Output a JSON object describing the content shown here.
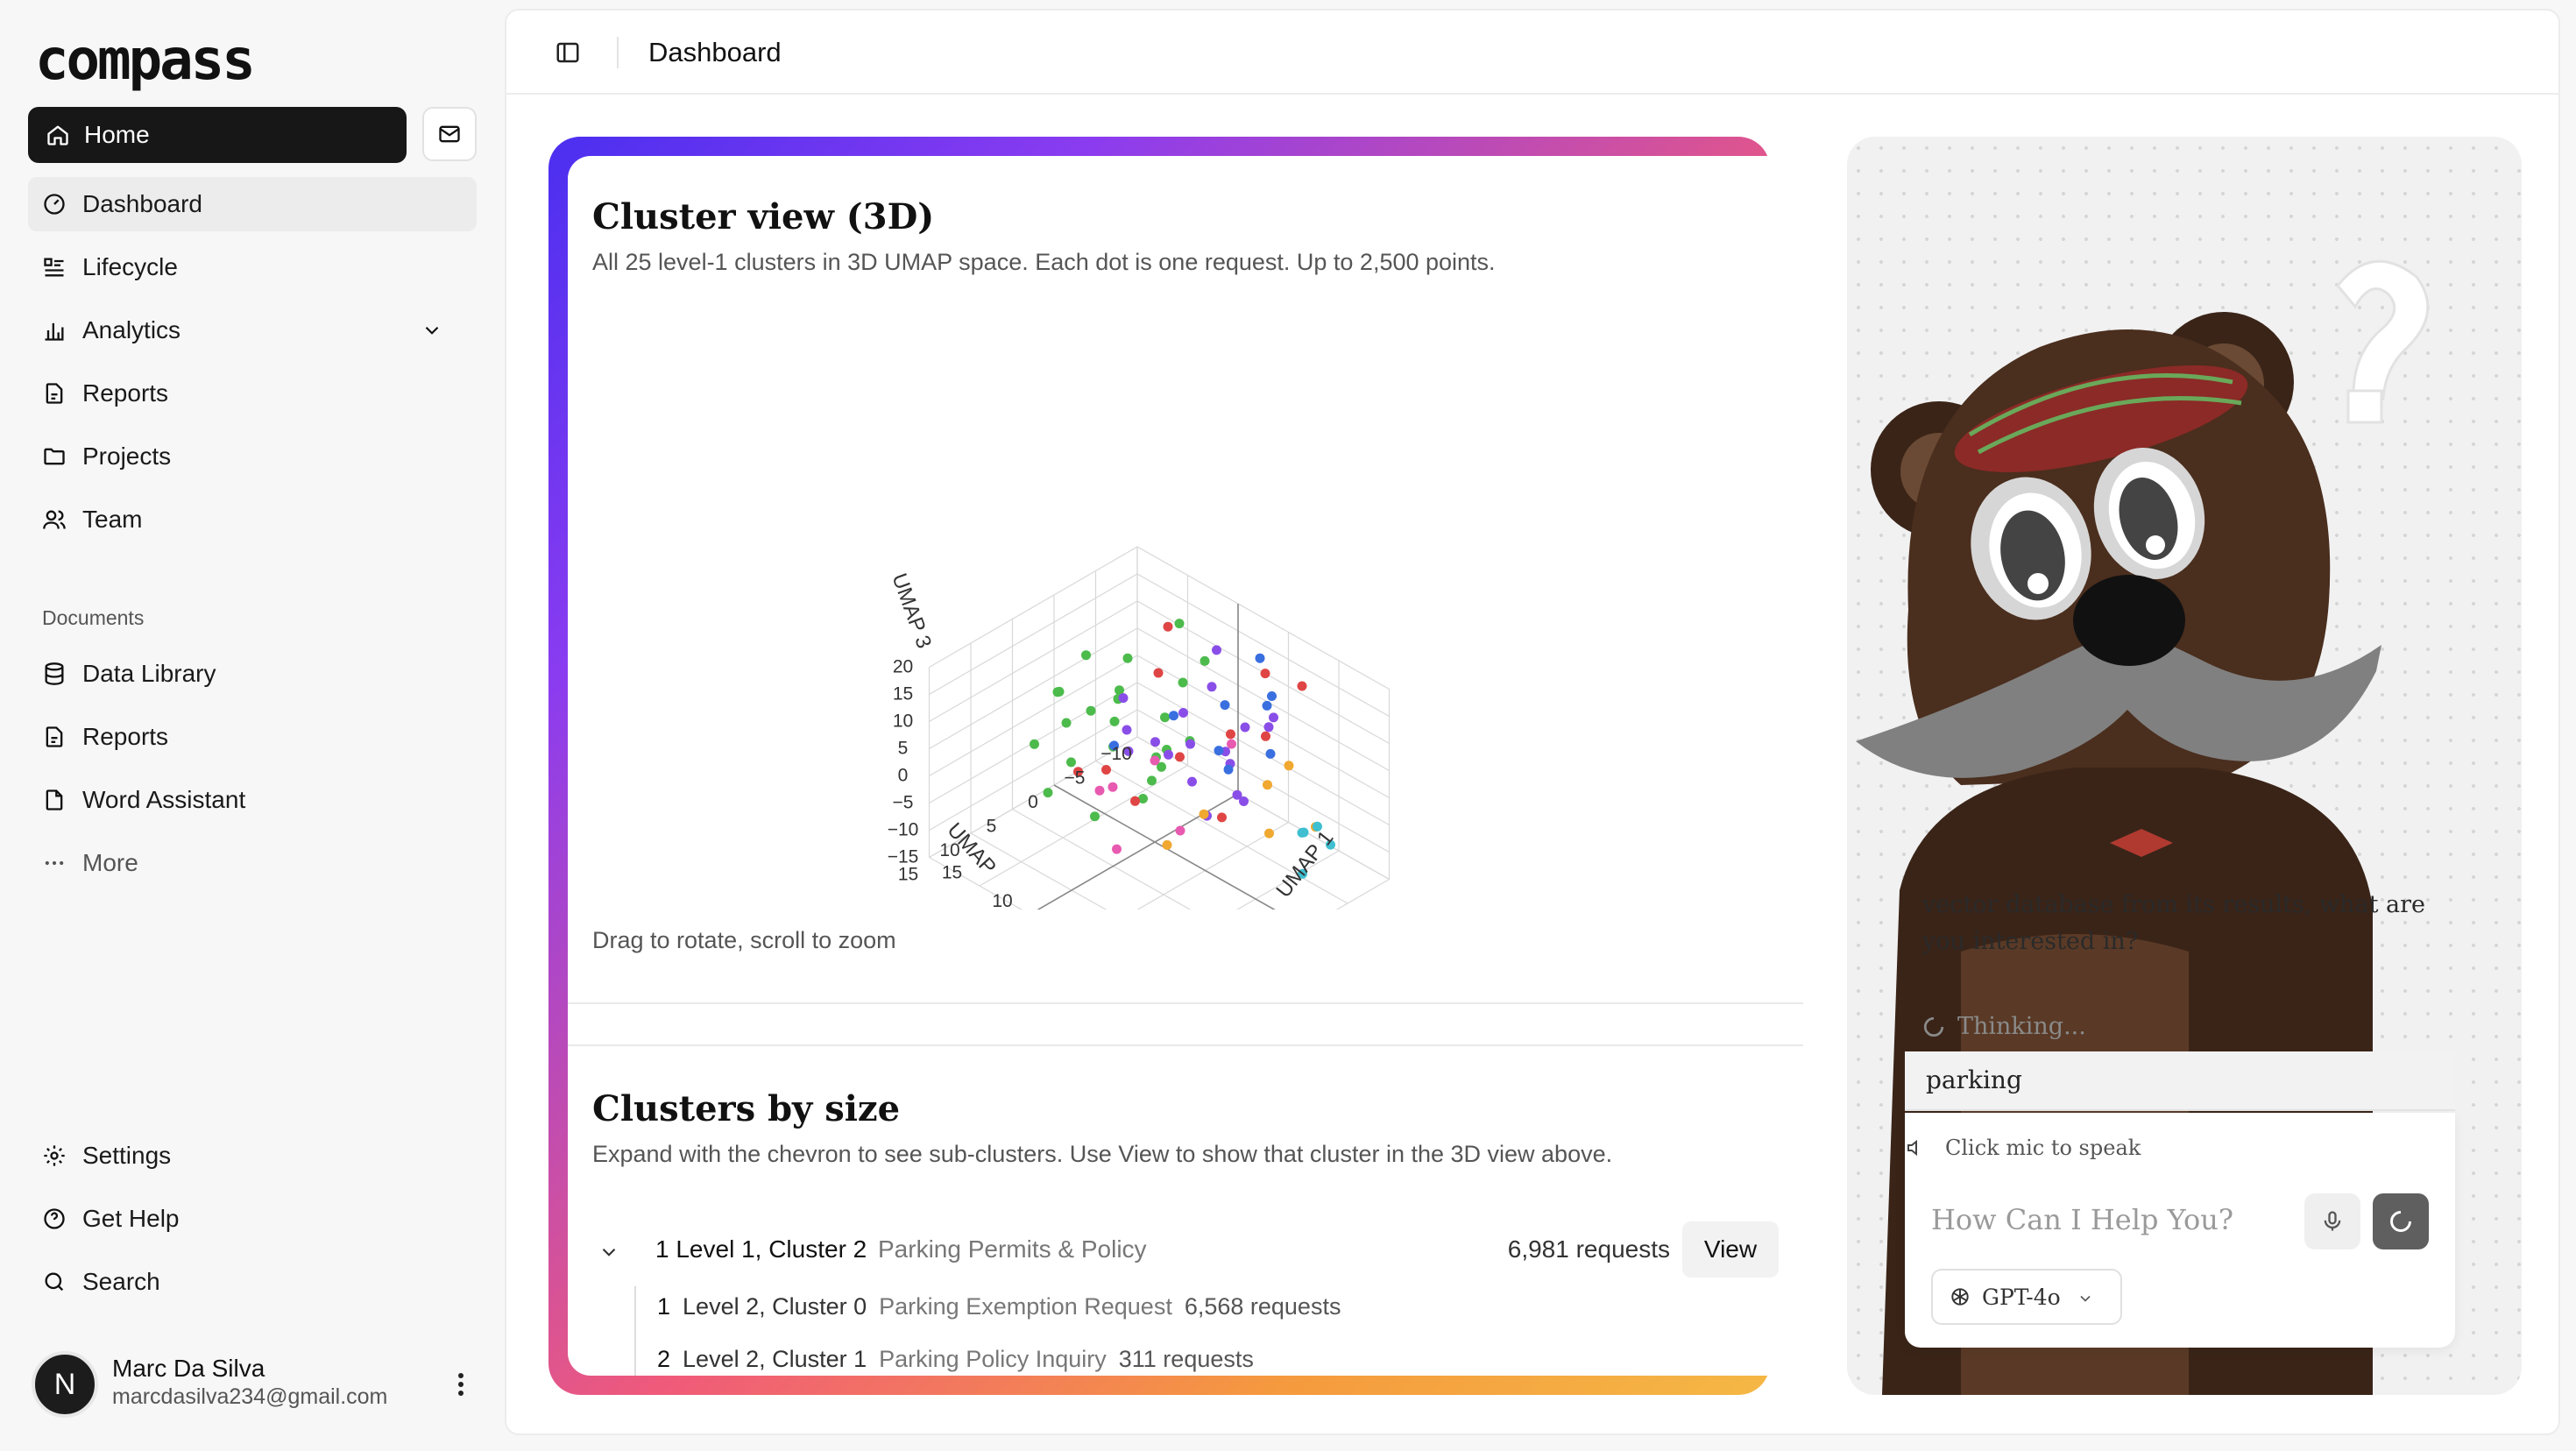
{
  "app": {
    "logo": "compass"
  },
  "sidebar": {
    "home_label": "Home",
    "items": [
      {
        "label": "Dashboard",
        "icon": "dashboard-icon"
      },
      {
        "label": "Lifecycle",
        "icon": "list-icon"
      },
      {
        "label": "Analytics",
        "icon": "bar-chart-icon"
      },
      {
        "label": "Reports",
        "icon": "report-icon"
      },
      {
        "label": "Projects",
        "icon": "folder-icon"
      },
      {
        "label": "Team",
        "icon": "users-icon"
      }
    ],
    "documents_label": "Documents",
    "doc_items": [
      {
        "label": "Data Library",
        "icon": "database-icon"
      },
      {
        "label": "Reports",
        "icon": "report-icon"
      },
      {
        "label": "Word Assistant",
        "icon": "document-icon"
      },
      {
        "label": "More",
        "icon": "more-icon"
      }
    ],
    "bottom_items": [
      {
        "label": "Settings",
        "icon": "gear-icon"
      },
      {
        "label": "Get Help",
        "icon": "help-icon"
      },
      {
        "label": "Search",
        "icon": "search-icon"
      }
    ],
    "user": {
      "initial": "N",
      "name": "Marc Da Silva",
      "email": "marcdasilva234@gmail.com"
    }
  },
  "header": {
    "breadcrumb": "Dashboard"
  },
  "cluster_view": {
    "title": "Cluster view (3D)",
    "subtitle": "All 25 level-1 clusters in 3D UMAP space. Each dot is one request. Up to 2,500 points.",
    "hint": "Drag to rotate, scroll to zoom",
    "axes": {
      "z_label": "UMAP 3",
      "x_label": "UMAP 1",
      "y_label": "UMAP",
      "z_ticks": [
        "20",
        "15",
        "10",
        "5",
        "0",
        "−5",
        "−10",
        "−15"
      ],
      "y_ticks": [
        "−10",
        "−5",
        "0",
        "5",
        "10",
        "15"
      ],
      "x_ticks": [
        "−10",
        "−5",
        "0",
        "5",
        "10",
        "15"
      ]
    }
  },
  "clusters_by_size": {
    "title": "Clusters by size",
    "subtitle": "Expand with the chevron to see sub-clusters. Use View to show that cluster in the 3D view above.",
    "top": {
      "rank": "1",
      "label": "Level 1, Cluster 2",
      "desc": "Parking Permits & Policy",
      "count": "6,981 requests",
      "view_label": "View"
    },
    "children": [
      {
        "rank": "1",
        "label": "Level 2, Cluster 0",
        "desc": "Parking Exemption Request",
        "count": "6,568 requests"
      },
      {
        "rank": "2",
        "label": "Level 2, Cluster 1",
        "desc": "Parking Policy Inquiry",
        "count": "311 requests"
      }
    ]
  },
  "assistant": {
    "message": "vector database from its results, what are you interested in?",
    "thinking": "Thinking...",
    "query": "parking",
    "mic_hint": "Click mic to speak",
    "input_placeholder": "How Can I Help You?",
    "model": "GPT-4o"
  },
  "chart_data": {
    "type": "scatter",
    "title": "Cluster view (3D)",
    "xlabel": "UMAP 1",
    "ylabel": "UMAP",
    "zlabel": "UMAP 3",
    "xlim": [
      -10,
      15
    ],
    "ylim": [
      -10,
      15
    ],
    "zlim": [
      -15,
      20
    ],
    "series": [
      {
        "color": "#4cbb4c",
        "points": [
          [
            -8,
            2,
            6
          ],
          [
            -6,
            -4,
            9
          ],
          [
            -4,
            0,
            3
          ],
          [
            -5,
            4,
            -2
          ],
          [
            -3,
            -7,
            5
          ],
          [
            -2,
            2,
            11
          ],
          [
            -7,
            6,
            1
          ],
          [
            -1,
            -2,
            -4
          ],
          [
            -6,
            1,
            14
          ],
          [
            0,
            5,
            7
          ],
          [
            -4,
            -5,
            -8
          ],
          [
            1,
            -3,
            2
          ],
          [
            -3,
            7,
            10
          ],
          [
            -8,
            -2,
            -1
          ],
          [
            2,
            1,
            5
          ],
          [
            -5,
            -9,
            12
          ],
          [
            -1,
            6,
            -6
          ],
          [
            -7,
            3,
            8
          ],
          [
            0,
            -6,
            13
          ],
          [
            -2,
            -1,
            -10
          ],
          [
            3,
            4,
            3
          ],
          [
            -6,
            -3,
            4
          ],
          [
            -4,
            8,
            -3
          ],
          [
            1,
            0,
            9
          ]
        ]
      },
      {
        "color": "#8a4ee8",
        "points": [
          [
            4,
            -2,
            16
          ],
          [
            6,
            3,
            12
          ],
          [
            2,
            -5,
            18
          ],
          [
            7,
            0,
            9
          ],
          [
            5,
            6,
            14
          ],
          [
            3,
            2,
            6
          ],
          [
            8,
            -4,
            11
          ],
          [
            1,
            5,
            17
          ],
          [
            6,
            -7,
            8
          ],
          [
            4,
            8,
            13
          ],
          [
            9,
            1,
            4
          ],
          [
            2,
            -1,
            10
          ],
          [
            5,
            -3,
            2
          ],
          [
            7,
            4,
            7
          ],
          [
            3,
            7,
            15
          ],
          [
            8,
            -1,
            0
          ],
          [
            6,
            1,
            -3
          ],
          [
            4,
            -6,
            5
          ]
        ]
      },
      {
        "color": "#e04545",
        "points": [
          [
            -2,
            -4,
            19
          ],
          [
            2,
            2,
            20
          ],
          [
            6,
            -6,
            17
          ],
          [
            10,
            3,
            18
          ],
          [
            -4,
            1,
            -5
          ],
          [
            0,
            -3,
            -2
          ],
          [
            3,
            6,
            1
          ],
          [
            5,
            -2,
            -7
          ],
          [
            -1,
            8,
            4
          ],
          [
            8,
            -8,
            15
          ],
          [
            11,
            0,
            16
          ]
        ]
      },
      {
        "color": "#3a6fe0",
        "points": [
          [
            5,
            -8,
            10
          ],
          [
            7,
            -5,
            13
          ],
          [
            9,
            -3,
            8
          ],
          [
            3,
            -9,
            14
          ],
          [
            6,
            5,
            19
          ],
          [
            -9,
            -6,
            -12
          ],
          [
            2,
            -6,
            7
          ],
          [
            4,
            -4,
            -1
          ],
          [
            8,
            2,
            12
          ]
        ]
      },
      {
        "color": "#f0a830",
        "points": [
          [
            10,
            -4,
            6
          ],
          [
            12,
            1,
            9
          ],
          [
            9,
            5,
            4
          ],
          [
            11,
            -6,
            -6
          ],
          [
            7,
            7,
            -2
          ],
          [
            13,
            2,
            2
          ]
        ]
      },
      {
        "color": "#3fbfd0",
        "points": [
          [
            9,
            -7,
            -10
          ],
          [
            12,
            -5,
            -4
          ],
          [
            10,
            -9,
            -13
          ],
          [
            13,
            -2,
            -9
          ],
          [
            8,
            -8,
            -12
          ]
        ]
      },
      {
        "color": "#e85ab0",
        "points": [
          [
            -3,
            3,
            -6
          ],
          [
            1,
            -8,
            -3
          ],
          [
            -5,
            -1,
            -11
          ],
          [
            2,
            7,
            -8
          ],
          [
            0,
            0,
            0
          ],
          [
            5,
            3,
            -5
          ]
        ]
      }
    ]
  },
  "colors": {
    "accent": "#171717",
    "gradient_start": "#4b2ff0",
    "gradient_end": "#f5b845"
  }
}
